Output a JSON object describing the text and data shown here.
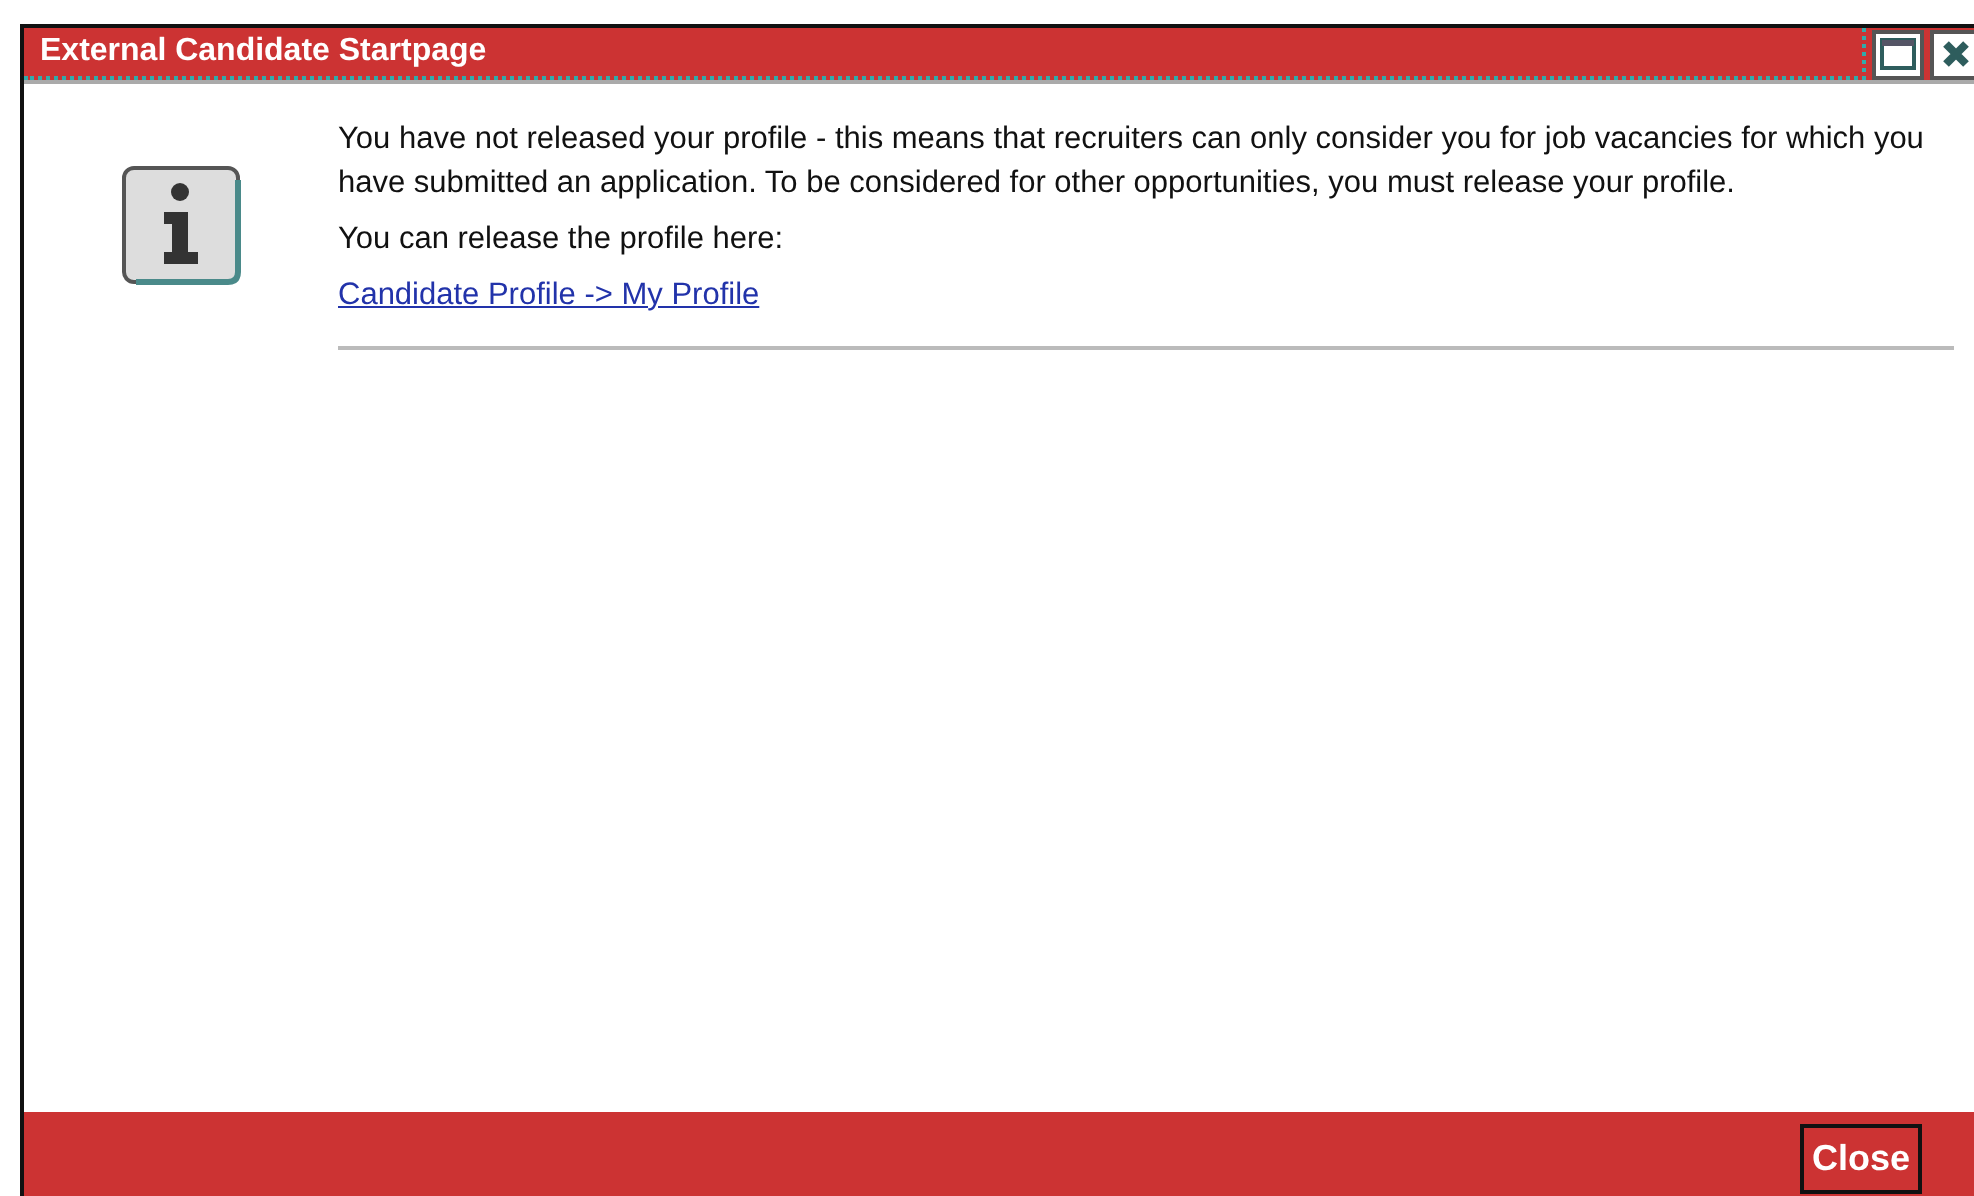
{
  "window": {
    "title": "External Candidate Startpage"
  },
  "message": {
    "paragraphs": [
      "You have not released your profile - this means that recruiters can only consider you for job vacancies for which you have submitted an application. To be considered for other opportunities, you must release your profile.",
      "You can release the profile here:"
    ],
    "link": "Candidate Profile -> My Profile"
  },
  "buttons": [
    "Close"
  ]
}
